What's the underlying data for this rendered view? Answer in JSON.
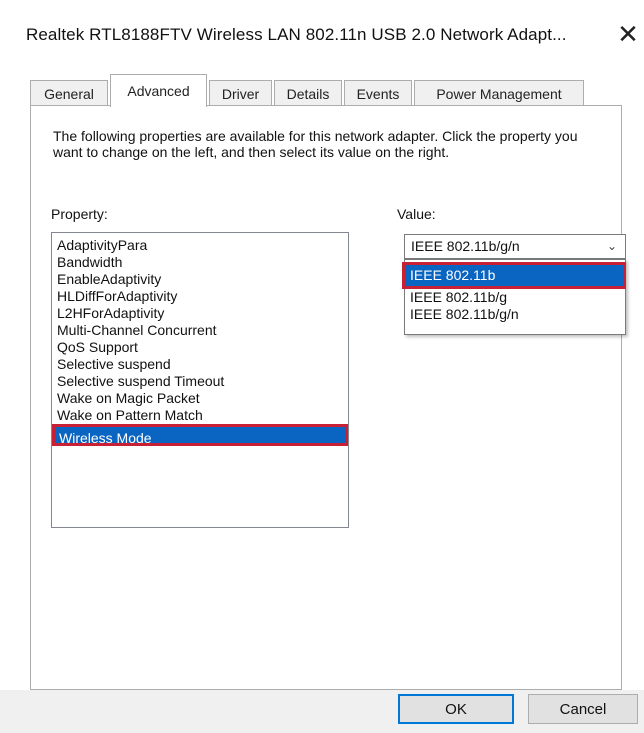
{
  "window": {
    "title": "Realtek RTL8188FTV Wireless LAN 802.11n USB 2.0 Network Adapt...",
    "close_glyph": "✕",
    "close_icon": "close-icon"
  },
  "tabs": [
    {
      "label": "General"
    },
    {
      "label": "Advanced",
      "active": true
    },
    {
      "label": "Driver"
    },
    {
      "label": "Details"
    },
    {
      "label": "Events"
    },
    {
      "label": "Power Management"
    }
  ],
  "panel": {
    "description": "The following properties are available for this network adapter. Click the property you want to change on the left, and then select its value on the right.",
    "property_label": "Property:",
    "value_label": "Value:"
  },
  "properties": [
    "AdaptivityPara",
    "Bandwidth",
    "EnableAdaptivity",
    "HLDiffForAdaptivity",
    "L2HForAdaptivity",
    "Multi-Channel Concurrent",
    "QoS Support",
    "Selective suspend",
    "Selective suspend Timeout",
    "Wake on Magic Packet",
    "Wake on Pattern Match",
    "Wireless Mode"
  ],
  "selected_property": "Wireless Mode",
  "value_combo": {
    "current": "IEEE 802.11b/g/n",
    "arrow_glyph": "⌄",
    "arrow_icon": "chevron-down-icon",
    "options": [
      "IEEE 802.11b",
      "IEEE 802.11b/g",
      "IEEE 802.11b/g/n"
    ],
    "highlighted": "IEEE 802.11b"
  },
  "buttons": {
    "ok": "OK",
    "cancel": "Cancel"
  },
  "colors": {
    "selection": "#0a64c2",
    "highlight_border": "#c82035",
    "default_button_border": "#0078d7"
  }
}
